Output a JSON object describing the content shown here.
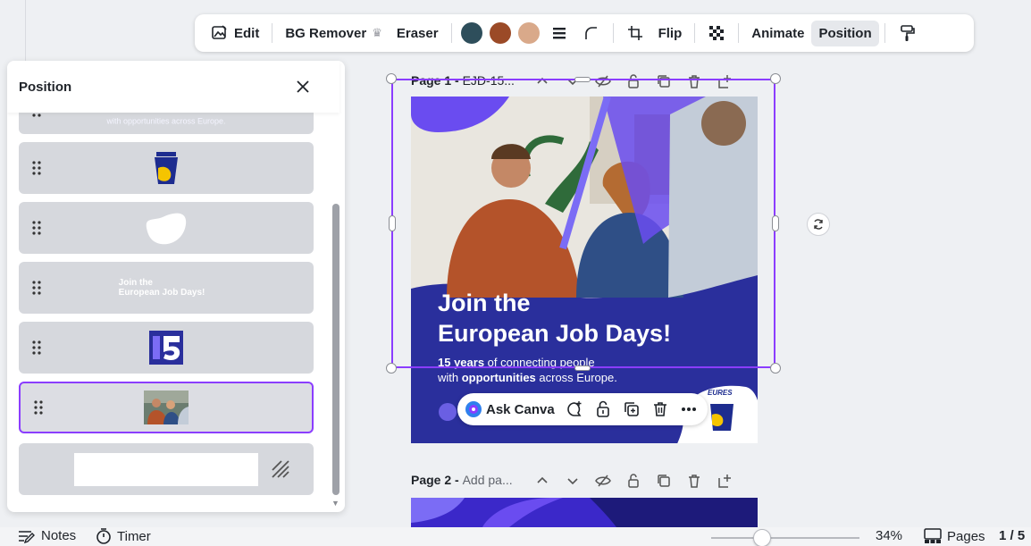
{
  "toolbar": {
    "edit_label": "Edit",
    "bg_remover_label": "BG Remover",
    "eraser_label": "Eraser",
    "swatches": [
      "#2e4e5b",
      "#9b4a27",
      "#d9a98a"
    ],
    "flip_label": "Flip",
    "animate_label": "Animate",
    "position_label": "Position"
  },
  "panel": {
    "title": "Position",
    "layers": [
      {
        "name": "text-opportunities",
        "thumb_text": "with opportunities across Europe."
      },
      {
        "name": "eures-logo"
      },
      {
        "name": "white-blob-shape"
      },
      {
        "name": "headline-text",
        "thumb_line1": "Join the",
        "thumb_line2": "European Job Days!"
      },
      {
        "name": "15-years-graphic"
      },
      {
        "name": "photo",
        "selected": true
      },
      {
        "name": "background-rectangle"
      }
    ]
  },
  "page1": {
    "label_bold": "Page 1 - ",
    "label_rest": "EJD-15..."
  },
  "design": {
    "headline1": "Join the",
    "headline2": "European Job Days!",
    "sub1_bold": "15 years",
    "sub1_rest": " of connecting people",
    "sub2_pre": "with ",
    "sub2_bold": "opportunities",
    "sub2_rest": " across Europe.",
    "logo_text": "EURES",
    "colors": {
      "navy": "#2a2f9c",
      "violet": "#6a4cf0",
      "selection": "#8b3dff"
    }
  },
  "ask_canva": {
    "label": "Ask Canva"
  },
  "page2": {
    "label_bold": "Page 2 - ",
    "label_rest": "Add pa..."
  },
  "bottombar": {
    "notes_label": "Notes",
    "timer_label": "Timer",
    "zoom_value": "34%",
    "pages_label": "Pages",
    "page_count": "1 / 5"
  }
}
